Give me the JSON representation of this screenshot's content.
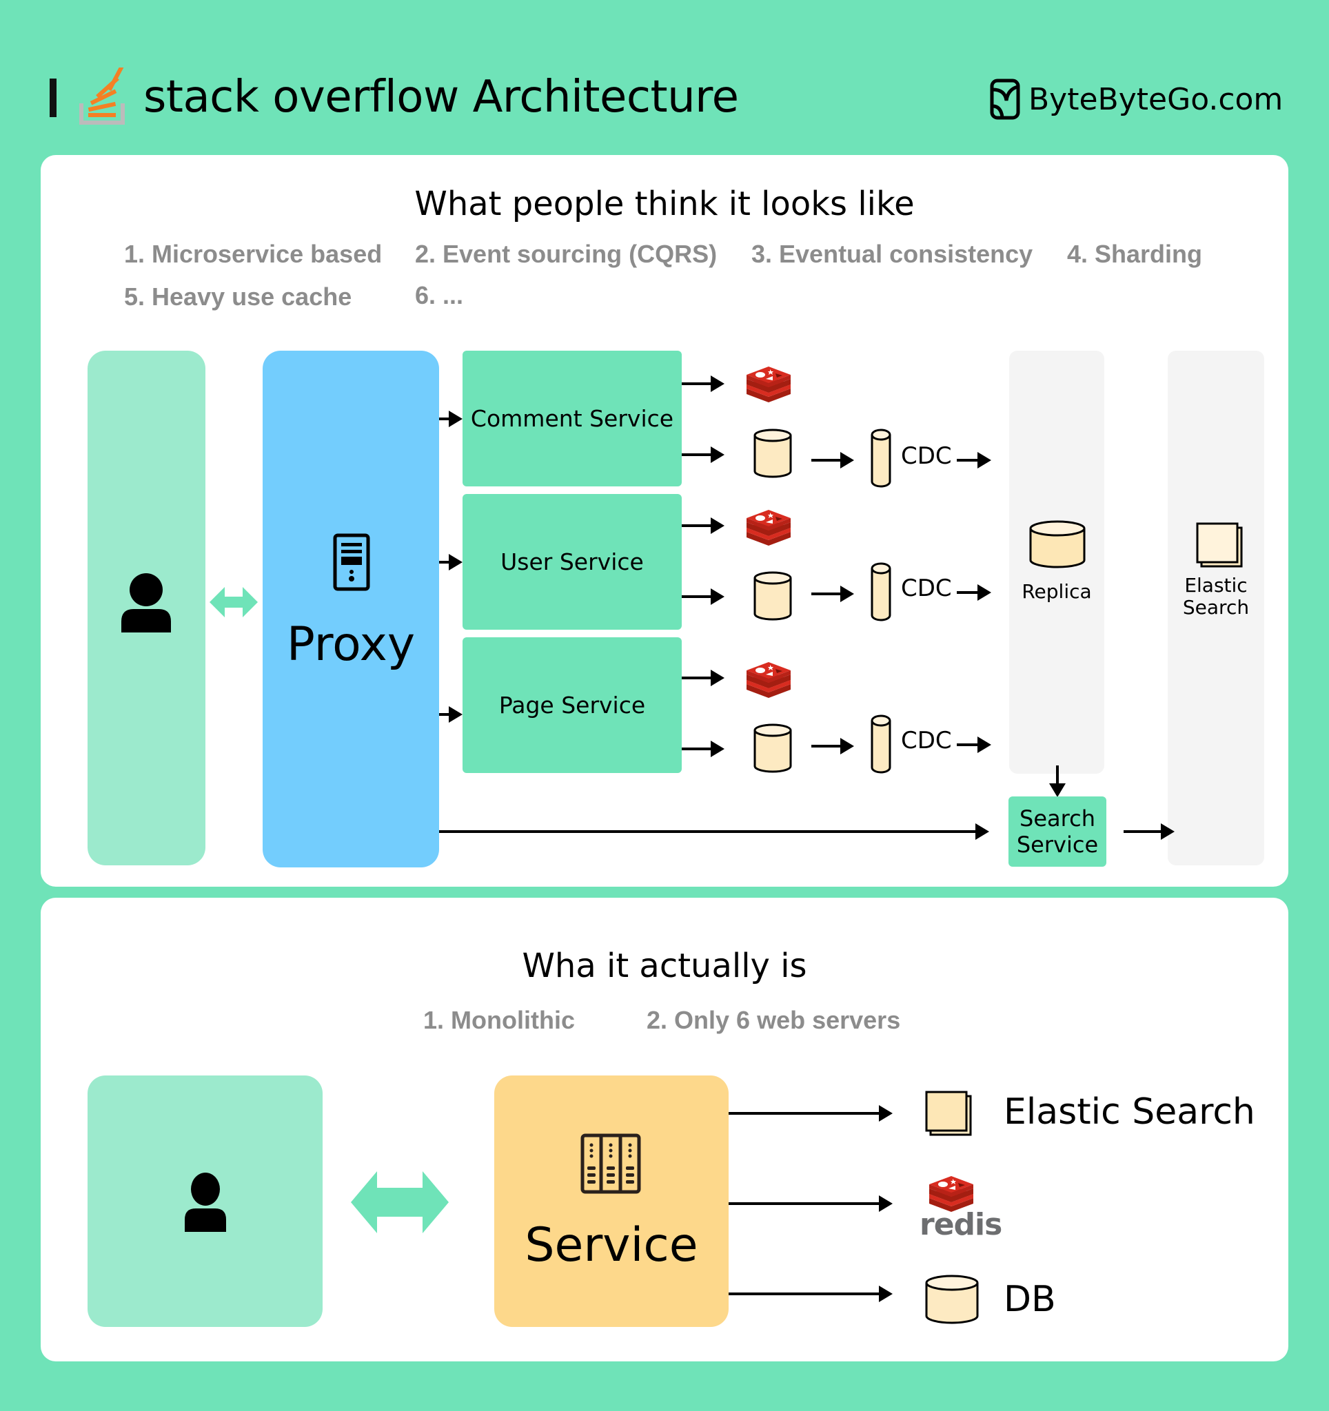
{
  "header": {
    "title": "stack overflow Architecture",
    "brand": "ByteByteGo.com",
    "colors": {
      "background": "#6fe3b8",
      "stackoverflow_orange": "#f48024",
      "stackoverflow_gray": "#bcbbbb"
    }
  },
  "top_section": {
    "title": "What people think it looks like",
    "bullets": [
      "1. Microservice based",
      "2. Event sourcing (CQRS)",
      "3. Eventual consistency",
      "4. Sharding",
      "5. Heavy use cache",
      "6. ..."
    ],
    "proxy_label": "Proxy",
    "services": [
      {
        "label": "Comment Service",
        "cdc_label": "CDC"
      },
      {
        "label": "User Service",
        "cdc_label": "CDC"
      },
      {
        "label": "Page Service",
        "cdc_label": "CDC"
      }
    ],
    "replica_label": "Replica",
    "elastic_label_line1": "Elastic",
    "elastic_label_line2": "Search",
    "search_service_line1": "Search",
    "search_service_line2": "Service",
    "colors": {
      "client": "#9ceacd",
      "proxy": "#73cdfd",
      "service": "#6fe3b8",
      "column": "#f4f4f4",
      "db": "#fdeac2",
      "redis": "#d82c20"
    }
  },
  "bottom_section": {
    "title": "Wha it actually is",
    "bullets": [
      "1.  Monolithic",
      "2. Only 6 web servers"
    ],
    "service_label": "Service",
    "targets": [
      {
        "label": "Elastic Search",
        "icon": "elastic-search-icon"
      },
      {
        "label": "redis",
        "icon": "redis-icon"
      },
      {
        "label": "DB",
        "icon": "database-icon"
      }
    ],
    "colors": {
      "service": "#fdd88b"
    }
  }
}
